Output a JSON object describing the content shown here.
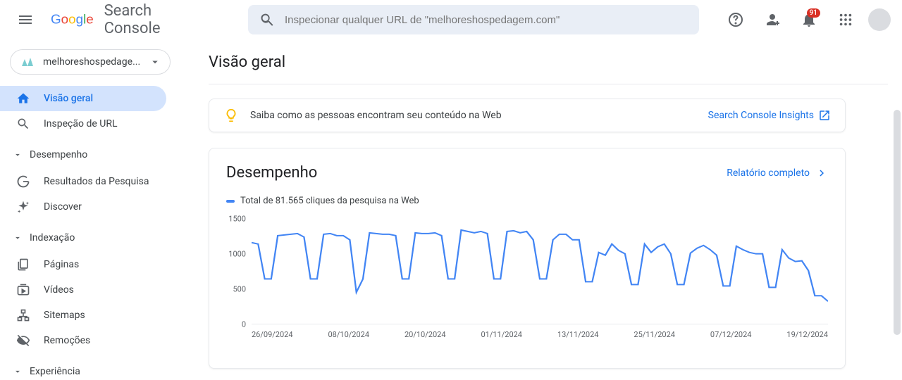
{
  "header": {
    "logo_text": "Search Console",
    "search_placeholder": "Inspecionar qualquer URL de \"melhoreshospedagem.com\"",
    "badge_count": "91"
  },
  "property": {
    "label": "melhoreshospedage..."
  },
  "sidebar": {
    "overview": "Visão geral",
    "url_inspect": "Inspeção de URL",
    "performance_section": "Desempenho",
    "search_results": "Resultados da Pesquisa",
    "discover": "Discover",
    "indexing_section": "Indexação",
    "pages": "Páginas",
    "videos": "Vídeos",
    "sitemaps": "Sitemaps",
    "removals": "Remoções",
    "experience_section": "Experiência"
  },
  "page": {
    "title": "Visão geral"
  },
  "insights": {
    "text": "Saiba como as pessoas encontram seu conteúdo na Web",
    "link": "Search Console Insights"
  },
  "performance": {
    "title": "Desempenho",
    "full_report": "Relatório completo",
    "legend": "Total de 81.565 cliques da pesquisa na Web"
  },
  "chart_data": {
    "type": "line",
    "title": "Total de 81.565 cliques da pesquisa na Web",
    "xlabel": "",
    "ylabel": "",
    "ylim": [
      0,
      1500
    ],
    "y_ticks": [
      "1500",
      "1000",
      "500",
      "0"
    ],
    "x_ticks": [
      "26/09/2024",
      "08/10/2024",
      "20/10/2024",
      "01/11/2024",
      "13/11/2024",
      "25/11/2024",
      "07/12/2024",
      "19/12/2024"
    ],
    "categories": [
      "26/09/2024",
      "27/09/2024",
      "28/09/2024",
      "29/09/2024",
      "30/09/2024",
      "01/10/2024",
      "02/10/2024",
      "03/10/2024",
      "04/10/2024",
      "05/10/2024",
      "06/10/2024",
      "07/10/2024",
      "08/10/2024",
      "09/10/2024",
      "10/10/2024",
      "11/10/2024",
      "12/10/2024",
      "13/10/2024",
      "14/10/2024",
      "15/10/2024",
      "16/10/2024",
      "17/10/2024",
      "18/10/2024",
      "19/10/2024",
      "20/10/2024",
      "21/10/2024",
      "22/10/2024",
      "23/10/2024",
      "24/10/2024",
      "25/10/2024",
      "26/10/2024",
      "27/10/2024",
      "28/10/2024",
      "29/10/2024",
      "30/10/2024",
      "31/10/2024",
      "01/11/2024",
      "02/11/2024",
      "03/11/2024",
      "04/11/2024",
      "05/11/2024",
      "06/11/2024",
      "07/11/2024",
      "08/11/2024",
      "09/11/2024",
      "10/11/2024",
      "11/11/2024",
      "12/11/2024",
      "13/11/2024",
      "14/11/2024",
      "15/11/2024",
      "16/11/2024",
      "17/11/2024",
      "18/11/2024",
      "19/11/2024",
      "20/11/2024",
      "21/11/2024",
      "22/11/2024",
      "23/11/2024",
      "24/11/2024",
      "25/11/2024",
      "26/11/2024",
      "27/11/2024",
      "28/11/2024",
      "29/11/2024",
      "30/11/2024",
      "01/12/2024",
      "02/12/2024",
      "03/12/2024",
      "04/12/2024",
      "05/12/2024",
      "06/12/2024",
      "07/12/2024",
      "08/12/2024",
      "09/12/2024",
      "10/12/2024",
      "11/12/2024",
      "12/12/2024",
      "13/12/2024",
      "14/12/2024",
      "15/12/2024",
      "16/12/2024",
      "17/12/2024",
      "18/12/2024",
      "19/12/2024",
      "20/12/2024",
      "21/12/2024",
      "22/12/2024",
      "23/12/2024"
    ],
    "values": [
      1160,
      1140,
      640,
      640,
      1260,
      1270,
      1280,
      1290,
      1240,
      640,
      640,
      1280,
      1290,
      1260,
      1260,
      1200,
      450,
      640,
      1300,
      1290,
      1280,
      1280,
      1260,
      640,
      640,
      1300,
      1290,
      1290,
      1300,
      1260,
      640,
      640,
      1340,
      1320,
      1300,
      1320,
      1290,
      640,
      640,
      1320,
      1330,
      1300,
      1320,
      1200,
      640,
      640,
      1200,
      1280,
      1280,
      1200,
      1200,
      600,
      600,
      1020,
      980,
      1140,
      1050,
      1000,
      560,
      560,
      1140,
      1020,
      1100,
      1140,
      1000,
      560,
      560,
      1010,
      1080,
      1120,
      1060,
      980,
      540,
      540,
      1110,
      1060,
      1020,
      1000,
      1000,
      520,
      520,
      1060,
      940,
      890,
      900,
      760,
      400,
      400,
      320
    ]
  }
}
